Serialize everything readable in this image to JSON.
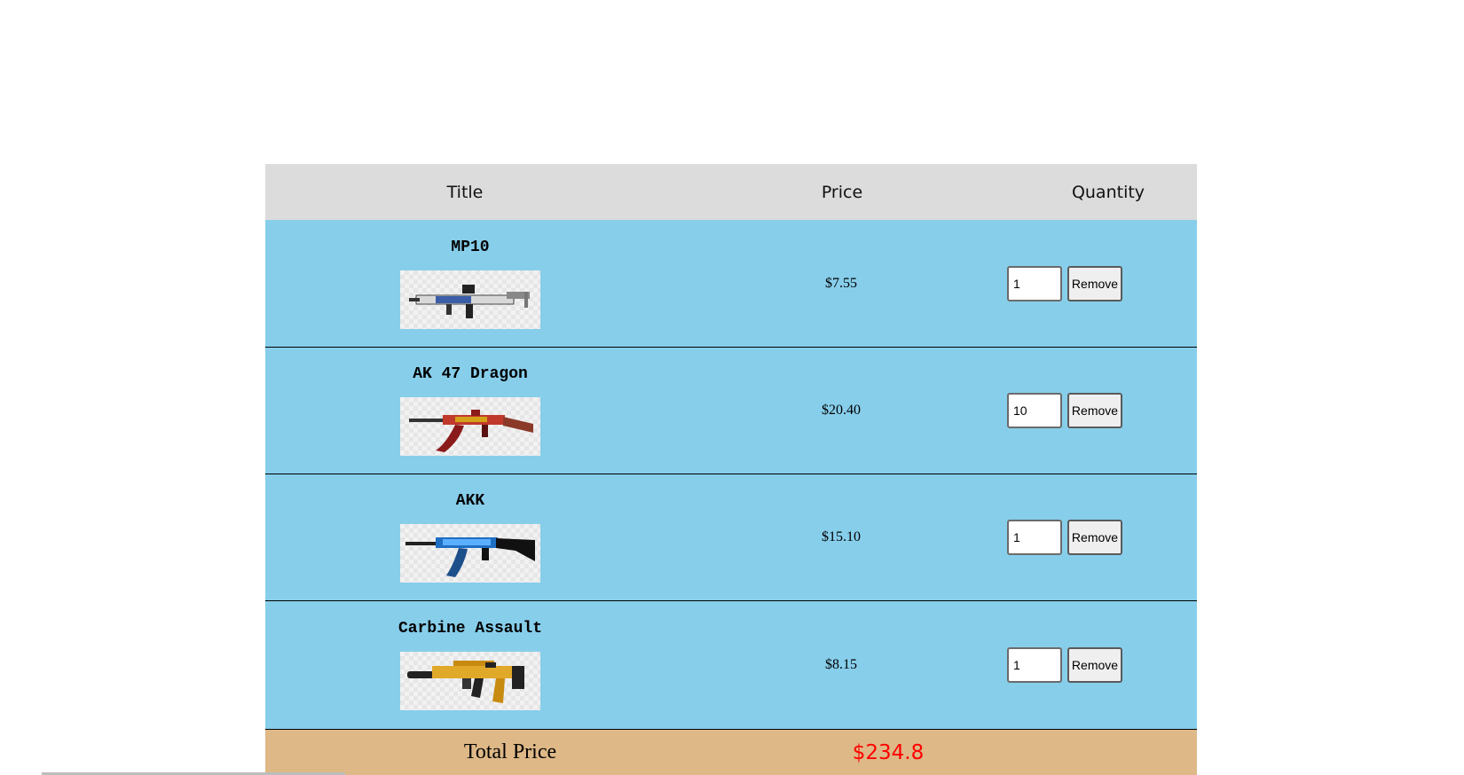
{
  "cart": {
    "header": {
      "title": "Title",
      "price": "Price",
      "quantity": "Quantity"
    },
    "items": [
      {
        "title": "MP10",
        "price": "$7.55",
        "quantity": "1",
        "remove_label": "Remove",
        "image_icon": "mp10-gun-image"
      },
      {
        "title": "AK 47 Dragon",
        "price": "$20.40",
        "quantity": "10",
        "remove_label": "Remove",
        "image_icon": "ak47-dragon-gun-image"
      },
      {
        "title": "AKK",
        "price": "$15.10",
        "quantity": "1",
        "remove_label": "Remove",
        "image_icon": "akk-gun-image"
      },
      {
        "title": "Carbine Assault",
        "price": "$8.15",
        "quantity": "1",
        "remove_label": "Remove",
        "image_icon": "carbine-assault-gun-image"
      }
    ],
    "total": {
      "label": "Total Price",
      "value": "$234.8"
    }
  },
  "colors": {
    "header_bg": "#dcdcdc",
    "row_bg": "#87ceeb",
    "total_bg": "#deb887",
    "total_value": "#ff0000"
  }
}
